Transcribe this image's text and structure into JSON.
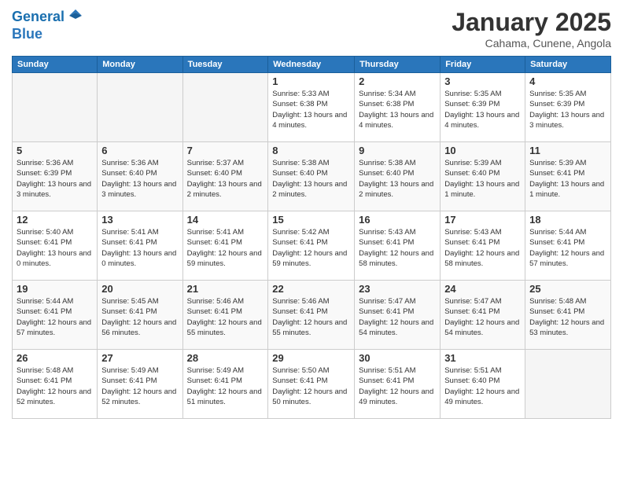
{
  "header": {
    "logo_line1": "General",
    "logo_line2": "Blue",
    "title": "January 2025",
    "subtitle": "Cahama, Cunene, Angola"
  },
  "weekdays": [
    "Sunday",
    "Monday",
    "Tuesday",
    "Wednesday",
    "Thursday",
    "Friday",
    "Saturday"
  ],
  "weeks": [
    [
      {
        "day": "",
        "sunrise": "",
        "sunset": "",
        "daylight": ""
      },
      {
        "day": "",
        "sunrise": "",
        "sunset": "",
        "daylight": ""
      },
      {
        "day": "",
        "sunrise": "",
        "sunset": "",
        "daylight": ""
      },
      {
        "day": "1",
        "sunrise": "Sunrise: 5:33 AM",
        "sunset": "Sunset: 6:38 PM",
        "daylight": "Daylight: 13 hours and 4 minutes."
      },
      {
        "day": "2",
        "sunrise": "Sunrise: 5:34 AM",
        "sunset": "Sunset: 6:38 PM",
        "daylight": "Daylight: 13 hours and 4 minutes."
      },
      {
        "day": "3",
        "sunrise": "Sunrise: 5:35 AM",
        "sunset": "Sunset: 6:39 PM",
        "daylight": "Daylight: 13 hours and 4 minutes."
      },
      {
        "day": "4",
        "sunrise": "Sunrise: 5:35 AM",
        "sunset": "Sunset: 6:39 PM",
        "daylight": "Daylight: 13 hours and 3 minutes."
      }
    ],
    [
      {
        "day": "5",
        "sunrise": "Sunrise: 5:36 AM",
        "sunset": "Sunset: 6:39 PM",
        "daylight": "Daylight: 13 hours and 3 minutes."
      },
      {
        "day": "6",
        "sunrise": "Sunrise: 5:36 AM",
        "sunset": "Sunset: 6:40 PM",
        "daylight": "Daylight: 13 hours and 3 minutes."
      },
      {
        "day": "7",
        "sunrise": "Sunrise: 5:37 AM",
        "sunset": "Sunset: 6:40 PM",
        "daylight": "Daylight: 13 hours and 2 minutes."
      },
      {
        "day": "8",
        "sunrise": "Sunrise: 5:38 AM",
        "sunset": "Sunset: 6:40 PM",
        "daylight": "Daylight: 13 hours and 2 minutes."
      },
      {
        "day": "9",
        "sunrise": "Sunrise: 5:38 AM",
        "sunset": "Sunset: 6:40 PM",
        "daylight": "Daylight: 13 hours and 2 minutes."
      },
      {
        "day": "10",
        "sunrise": "Sunrise: 5:39 AM",
        "sunset": "Sunset: 6:40 PM",
        "daylight": "Daylight: 13 hours and 1 minute."
      },
      {
        "day": "11",
        "sunrise": "Sunrise: 5:39 AM",
        "sunset": "Sunset: 6:41 PM",
        "daylight": "Daylight: 13 hours and 1 minute."
      }
    ],
    [
      {
        "day": "12",
        "sunrise": "Sunrise: 5:40 AM",
        "sunset": "Sunset: 6:41 PM",
        "daylight": "Daylight: 13 hours and 0 minutes."
      },
      {
        "day": "13",
        "sunrise": "Sunrise: 5:41 AM",
        "sunset": "Sunset: 6:41 PM",
        "daylight": "Daylight: 13 hours and 0 minutes."
      },
      {
        "day": "14",
        "sunrise": "Sunrise: 5:41 AM",
        "sunset": "Sunset: 6:41 PM",
        "daylight": "Daylight: 12 hours and 59 minutes."
      },
      {
        "day": "15",
        "sunrise": "Sunrise: 5:42 AM",
        "sunset": "Sunset: 6:41 PM",
        "daylight": "Daylight: 12 hours and 59 minutes."
      },
      {
        "day": "16",
        "sunrise": "Sunrise: 5:43 AM",
        "sunset": "Sunset: 6:41 PM",
        "daylight": "Daylight: 12 hours and 58 minutes."
      },
      {
        "day": "17",
        "sunrise": "Sunrise: 5:43 AM",
        "sunset": "Sunset: 6:41 PM",
        "daylight": "Daylight: 12 hours and 58 minutes."
      },
      {
        "day": "18",
        "sunrise": "Sunrise: 5:44 AM",
        "sunset": "Sunset: 6:41 PM",
        "daylight": "Daylight: 12 hours and 57 minutes."
      }
    ],
    [
      {
        "day": "19",
        "sunrise": "Sunrise: 5:44 AM",
        "sunset": "Sunset: 6:41 PM",
        "daylight": "Daylight: 12 hours and 57 minutes."
      },
      {
        "day": "20",
        "sunrise": "Sunrise: 5:45 AM",
        "sunset": "Sunset: 6:41 PM",
        "daylight": "Daylight: 12 hours and 56 minutes."
      },
      {
        "day": "21",
        "sunrise": "Sunrise: 5:46 AM",
        "sunset": "Sunset: 6:41 PM",
        "daylight": "Daylight: 12 hours and 55 minutes."
      },
      {
        "day": "22",
        "sunrise": "Sunrise: 5:46 AM",
        "sunset": "Sunset: 6:41 PM",
        "daylight": "Daylight: 12 hours and 55 minutes."
      },
      {
        "day": "23",
        "sunrise": "Sunrise: 5:47 AM",
        "sunset": "Sunset: 6:41 PM",
        "daylight": "Daylight: 12 hours and 54 minutes."
      },
      {
        "day": "24",
        "sunrise": "Sunrise: 5:47 AM",
        "sunset": "Sunset: 6:41 PM",
        "daylight": "Daylight: 12 hours and 54 minutes."
      },
      {
        "day": "25",
        "sunrise": "Sunrise: 5:48 AM",
        "sunset": "Sunset: 6:41 PM",
        "daylight": "Daylight: 12 hours and 53 minutes."
      }
    ],
    [
      {
        "day": "26",
        "sunrise": "Sunrise: 5:48 AM",
        "sunset": "Sunset: 6:41 PM",
        "daylight": "Daylight: 12 hours and 52 minutes."
      },
      {
        "day": "27",
        "sunrise": "Sunrise: 5:49 AM",
        "sunset": "Sunset: 6:41 PM",
        "daylight": "Daylight: 12 hours and 52 minutes."
      },
      {
        "day": "28",
        "sunrise": "Sunrise: 5:49 AM",
        "sunset": "Sunset: 6:41 PM",
        "daylight": "Daylight: 12 hours and 51 minutes."
      },
      {
        "day": "29",
        "sunrise": "Sunrise: 5:50 AM",
        "sunset": "Sunset: 6:41 PM",
        "daylight": "Daylight: 12 hours and 50 minutes."
      },
      {
        "day": "30",
        "sunrise": "Sunrise: 5:51 AM",
        "sunset": "Sunset: 6:41 PM",
        "daylight": "Daylight: 12 hours and 49 minutes."
      },
      {
        "day": "31",
        "sunrise": "Sunrise: 5:51 AM",
        "sunset": "Sunset: 6:40 PM",
        "daylight": "Daylight: 12 hours and 49 minutes."
      },
      {
        "day": "",
        "sunrise": "",
        "sunset": "",
        "daylight": ""
      }
    ]
  ]
}
